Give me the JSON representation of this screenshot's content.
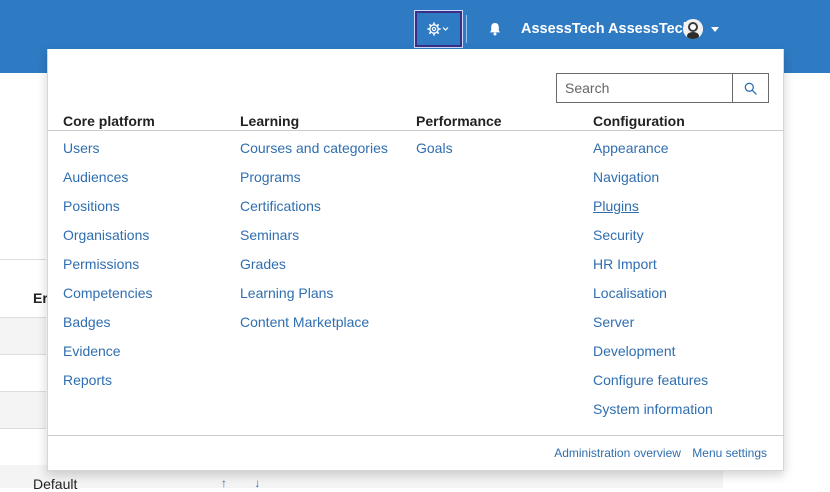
{
  "header": {
    "user_name": "AssessTech AssessTech",
    "gear_icon": "gear-icon",
    "bell_icon": "bell-icon",
    "brand_color": "#2e7bc4"
  },
  "background": {
    "column_header_fragment": "Er",
    "row_text": "Default",
    "arrows": "↑ ↓"
  },
  "menu": {
    "search": {
      "placeholder": "Search"
    },
    "columns": [
      {
        "title": "Core platform",
        "items": [
          "Users",
          "Audiences",
          "Positions",
          "Organisations",
          "Permissions",
          "Competencies",
          "Badges",
          "Evidence",
          "Reports"
        ]
      },
      {
        "title": "Learning",
        "items": [
          "Courses and categories",
          "Programs",
          "Certifications",
          "Seminars",
          "Grades",
          "Learning Plans",
          "Content Marketplace"
        ]
      },
      {
        "title": "Performance",
        "items": [
          "Goals"
        ]
      },
      {
        "title": "Configuration",
        "items": [
          "Appearance",
          "Navigation",
          "Plugins",
          "Security",
          "HR Import",
          "Localisation",
          "Server",
          "Development",
          "Configure features",
          "System information"
        ]
      }
    ],
    "footer": {
      "overview_label": "Administration overview",
      "settings_label": "Menu settings"
    },
    "link_color": "#2f6eb0"
  }
}
